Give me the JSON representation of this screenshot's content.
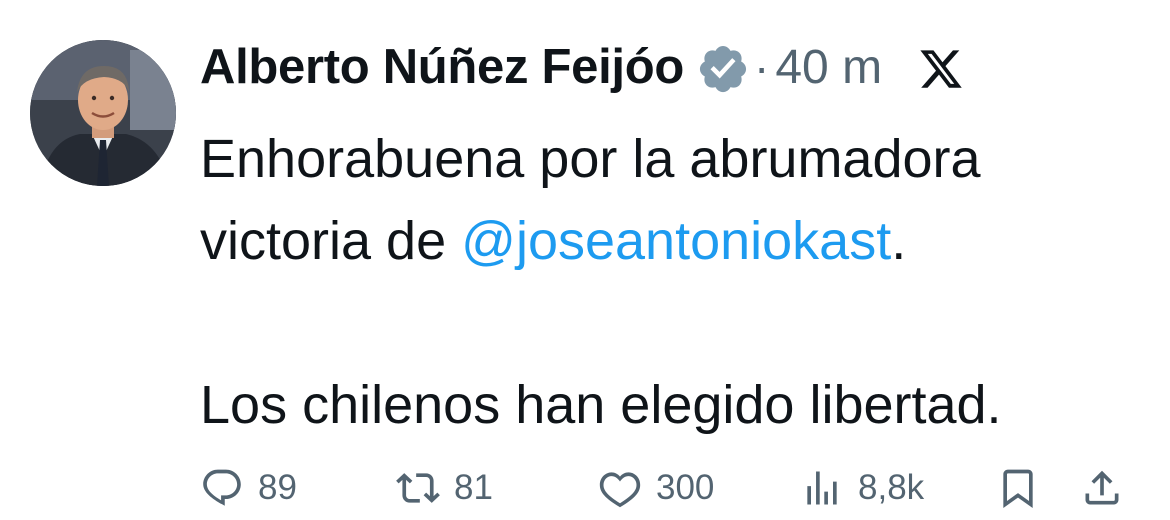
{
  "tweet": {
    "author_name": "Alberto Núñez Feijóo",
    "separator": "·",
    "time_ago": "40 m",
    "text_line1": "Enhorabuena por la abrumadora",
    "text_line2_prefix": "victoria de ",
    "mention": "@joseantoniokast",
    "text_line2_suffix": ".",
    "text_line3": "Los chilenos han elegido libertad."
  },
  "actions": {
    "replies": "89",
    "reposts": "81",
    "likes": "300",
    "views": "8,8k"
  },
  "icons": {
    "verified": "verified-badge-icon",
    "platform": "x-logo-icon",
    "reply": "reply-icon",
    "repost": "repost-icon",
    "like": "heart-icon",
    "views": "views-icon",
    "bookmark": "bookmark-icon",
    "share": "share-icon"
  },
  "colors": {
    "text": "#0f1419",
    "secondary": "#536471",
    "mention": "#1d9bf0",
    "verified_badge": "#829aab"
  }
}
